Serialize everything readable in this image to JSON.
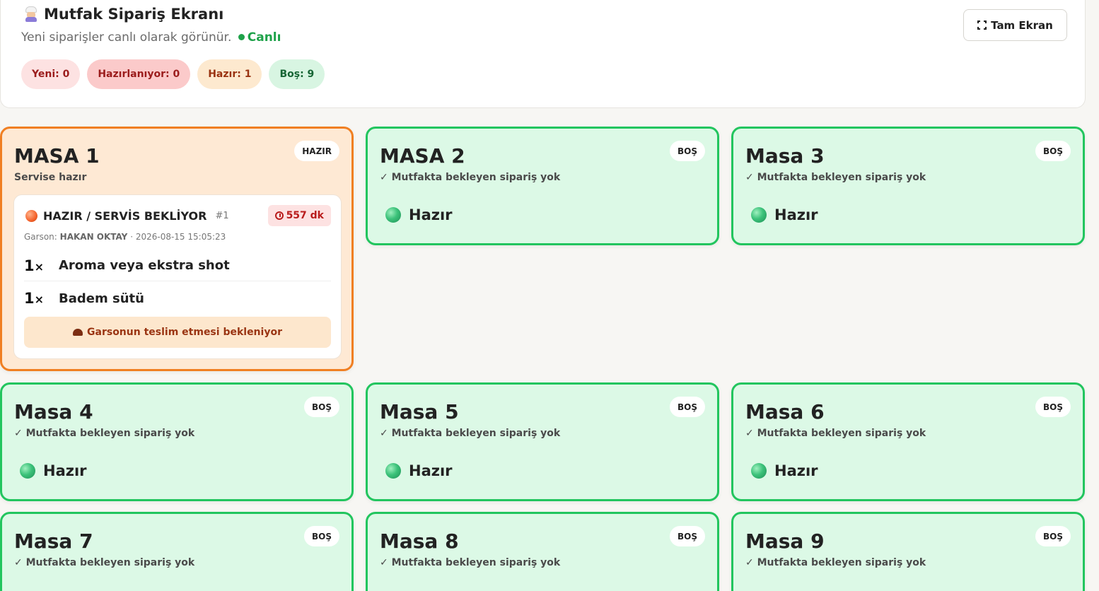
{
  "header": {
    "title": "Mutfak Sipariş Ekranı",
    "subtitle": "Yeni siparişler canlı olarak görünür.",
    "live_label": "Canlı",
    "fullscreen_label": "Tam Ekran",
    "counts": {
      "yeni": "Yeni: 0",
      "hazirlaniyor": "Hazırlanıyor: 0",
      "hazir": "Hazır: 1",
      "bos": "Boş: 9"
    }
  },
  "tables": [
    {
      "name": "MASA 1",
      "badge": "HAZIR",
      "subtitle": "Servise hazır",
      "order": {
        "status": "HAZIR / SERVİS BEKLİYOR",
        "number": "#1",
        "timer": "557 dk",
        "waiter_prefix": "Garson:",
        "waiter_name": "HAKAN OKTAY",
        "timestamp": "· 2026-08-15 15:05:23",
        "items": [
          {
            "qty": "1",
            "unit": "×",
            "name": "Aroma veya ekstra shot"
          },
          {
            "qty": "1",
            "unit": "×",
            "name": "Badem sütü"
          }
        ],
        "footer": "Garsonun teslim etmesi bekleniyor"
      }
    },
    {
      "name": "MASA 2",
      "badge": "BOŞ",
      "subtitle": "✓ Mutfakta bekleyen sipariş yok",
      "ready_label": "Hazır"
    },
    {
      "name": "Masa 3",
      "badge": "BOŞ",
      "subtitle": "✓ Mutfakta bekleyen sipariş yok",
      "ready_label": "Hazır"
    },
    {
      "name": "Masa 4",
      "badge": "BOŞ",
      "subtitle": "✓ Mutfakta bekleyen sipariş yok",
      "ready_label": "Hazır"
    },
    {
      "name": "Masa 5",
      "badge": "BOŞ",
      "subtitle": "✓ Mutfakta bekleyen sipariş yok",
      "ready_label": "Hazır"
    },
    {
      "name": "Masa 6",
      "badge": "BOŞ",
      "subtitle": "✓ Mutfakta bekleyen sipariş yok",
      "ready_label": "Hazır"
    },
    {
      "name": "Masa 7",
      "badge": "BOŞ",
      "subtitle": "✓ Mutfakta bekleyen sipariş yok"
    },
    {
      "name": "Masa 8",
      "badge": "BOŞ",
      "subtitle": "✓ Mutfakta bekleyen sipariş yok"
    },
    {
      "name": "Masa 9",
      "badge": "BOŞ",
      "subtitle": "✓ Mutfakta bekleyen sipariş yok"
    }
  ],
  "colors": {
    "empty_bg": "#dcf9e6",
    "empty_border": "#22c55e",
    "ready_bg": "#fee9d4",
    "ready_border": "#f07f22",
    "live": "#1fa24a"
  }
}
